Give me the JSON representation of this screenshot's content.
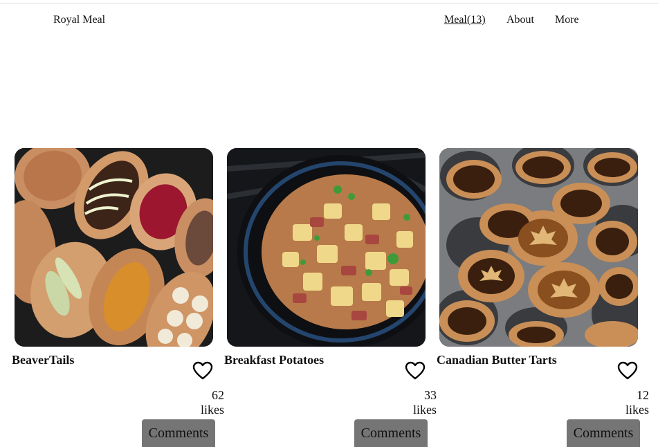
{
  "header": {
    "brand": "Royal Meal",
    "nav": [
      {
        "label": "Meal(13)",
        "active": true
      },
      {
        "label": "About",
        "active": false
      },
      {
        "label": "More",
        "active": false
      }
    ]
  },
  "meals": [
    {
      "title": "BeaverTails",
      "image": "beavertails-pastries-photo",
      "likes_count": "62",
      "likes_label": "likes",
      "button_label": "Comments"
    },
    {
      "title": "Breakfast Potatoes",
      "image": "breakfast-potatoes-skillet-photo",
      "likes_count": "33",
      "likes_label": "likes",
      "button_label": "Comments"
    },
    {
      "title": "Canadian Butter Tarts",
      "image": "butter-tarts-tray-photo",
      "likes_count": "12",
      "likes_label": "likes",
      "button_label": "Comments"
    }
  ],
  "icons": {
    "like": "heart-outline-icon"
  },
  "colors": {
    "button": "#757575",
    "text": "#111111",
    "divider": "#d9d9d9"
  }
}
